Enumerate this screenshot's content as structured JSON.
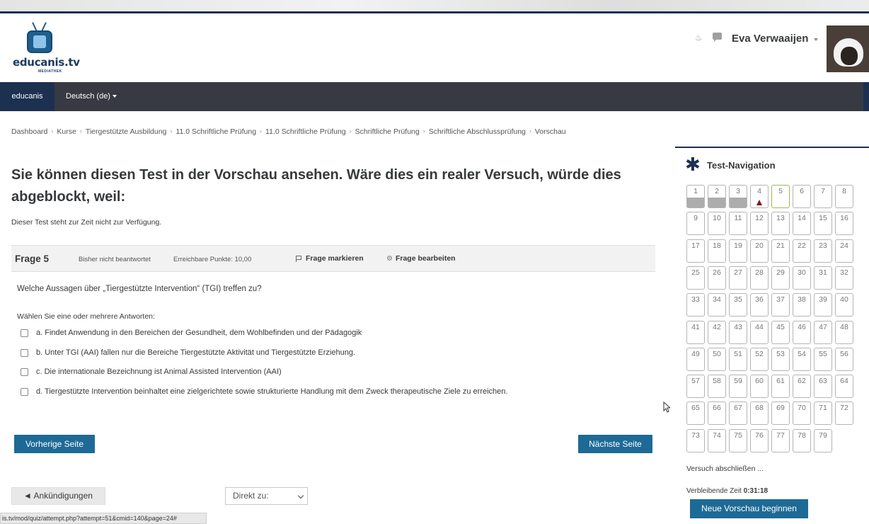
{
  "brand": {
    "name": "educanis.tv",
    "sub": "MEDIATHEK"
  },
  "user": {
    "name": "Eva Verwaaijen"
  },
  "navbar": {
    "home": "educanis",
    "language": "Deutsch (de)"
  },
  "breadcrumb": [
    "Dashboard",
    "Kurse",
    "Tiergestützte Ausbildung",
    "11.0 Schriftliche Prüfung",
    "11.0 Schriftliche Prüfung",
    "Schriftliche Prüfung",
    "Schriftliche Abschlussprüfung",
    "Vorschau"
  ],
  "page": {
    "title": "Sie können diesen Test in der Vorschau ansehen. Wäre dies ein realer Versuch, würde dies abgeblockt, weil:",
    "message": "Dieser Test steht zur Zeit nicht zur Verfügung."
  },
  "question": {
    "number_label": "Frage 5",
    "state": "Bisher nicht beantwortet",
    "points": "Erreichbare Punkte: 10,00",
    "flag_label": "Frage markieren",
    "edit_label": "Frage bearbeiten",
    "text": "Welche Aussagen über „Tiergestützte Intervention“ (TGI) treffen zu?",
    "prompt": "Wählen Sie eine oder mehrere Antworten:",
    "answers": [
      "a. Findet Anwendung in den Bereichen der Gesundheit, dem Wohlbefinden und der Pädagogik",
      "b. Unter TGI (AAI) fallen nur die Bereiche Tiergestützte Aktivität und Tiergestützte Erziehung.",
      "c. Die internationale Bezeichnung ist Animal Assisted Intervention (AAI)",
      "d. Tiergestützte Intervention beinhaltet eine zielgerichtete sowie strukturierte Handlung mit dem Zweck therapeutische Ziele zu erreichen."
    ]
  },
  "buttons": {
    "prev": "Vorherige Seite",
    "next": "Nächste Seite",
    "announcements": "◄ Ankündigungen",
    "jump": "Direkt zu:"
  },
  "status_url": "is.tv/mod/quiz/attempt.php?attempt=51&cmid=140&page=24#",
  "test_nav": {
    "title": "Test-Navigation",
    "total": 79,
    "answered": [
      1,
      2,
      3
    ],
    "flagged": [
      4
    ],
    "current": 5,
    "finish_label": "Versuch abschließen ...",
    "time_label": "Verbleibende Zeit",
    "time_value": "0:31:18",
    "new_preview": "Neue Vorschau beginnen"
  },
  "colors": {
    "primary": "#1e6a96",
    "navbar": "#373a42",
    "accent_dark": "#1c3050"
  }
}
